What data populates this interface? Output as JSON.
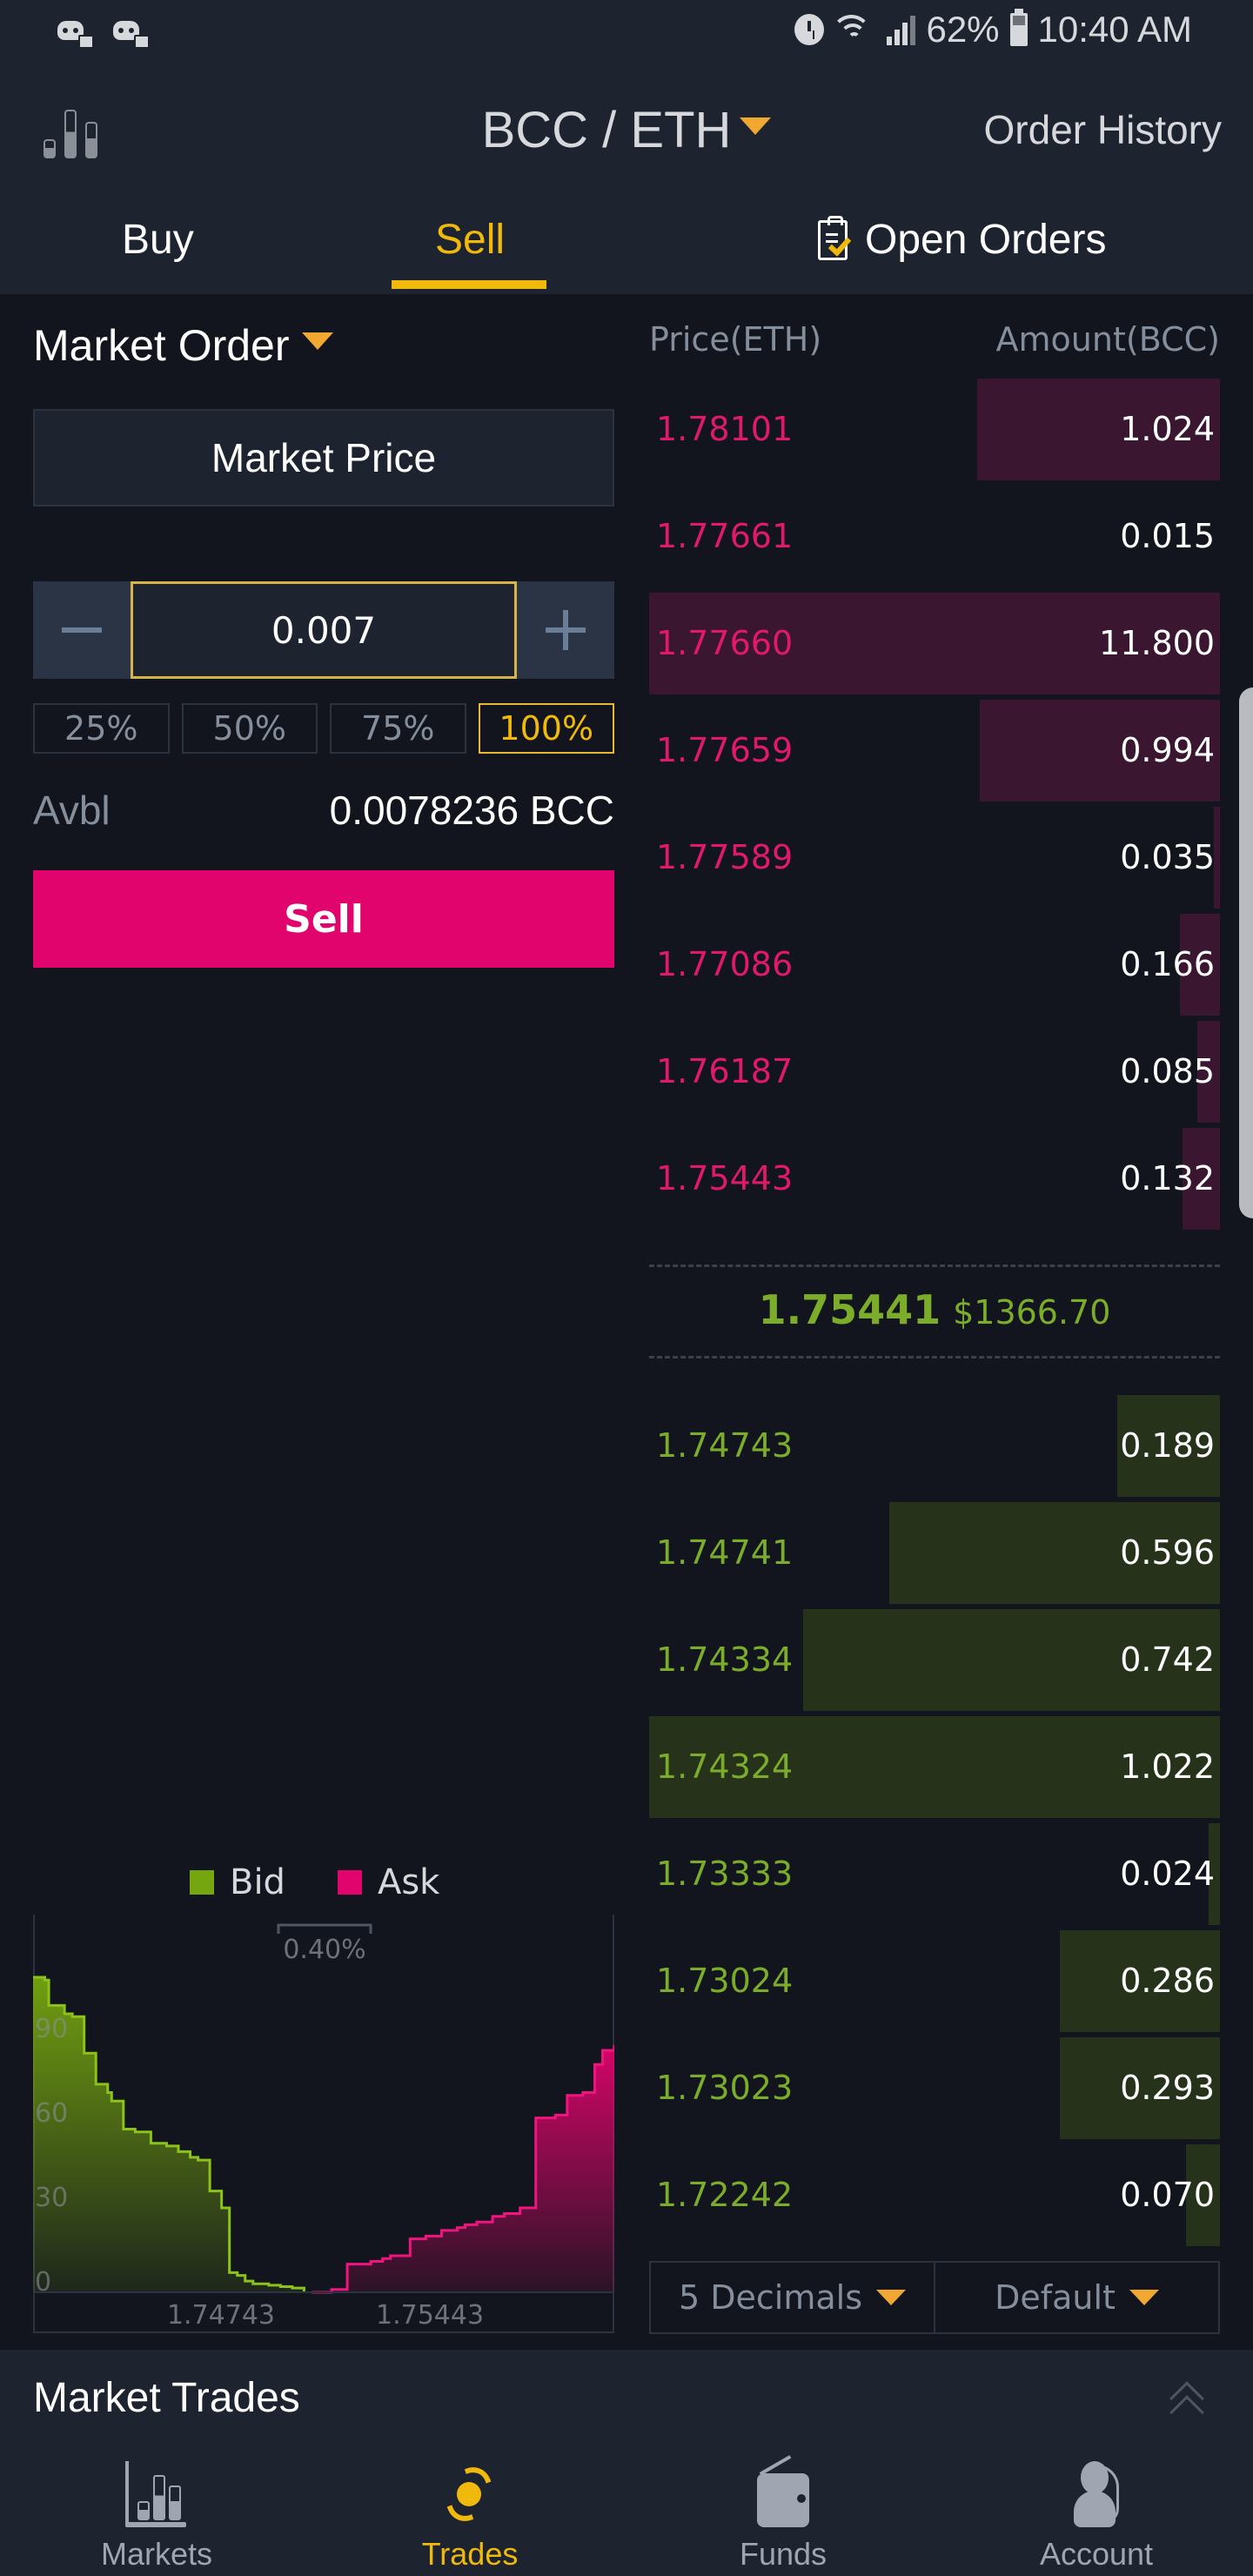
{
  "status_bar": {
    "notification_icons": [
      "discord-icon",
      "discord-icon"
    ],
    "battery_percent": "62%",
    "time": "10:40 AM",
    "icons": [
      "alarm-icon",
      "wifi-icon",
      "signal-icon",
      "battery-icon"
    ]
  },
  "header": {
    "pair": "BCC / ETH",
    "order_history": "Order History"
  },
  "tabs": [
    {
      "label": "Buy",
      "active": false
    },
    {
      "label": "Sell",
      "active": true
    },
    {
      "label": "Open Orders",
      "active": false
    }
  ],
  "form": {
    "order_type": "Market Order",
    "price_display": "Market Price",
    "amount": "0.007",
    "percent_options": [
      "25%",
      "50%",
      "75%",
      "100%"
    ],
    "selected_percent": "100%",
    "avbl_label": "Avbl",
    "avbl_value": "0.0078236",
    "avbl_currency": "BCC",
    "submit_label": "Sell"
  },
  "order_book": {
    "header_price": "Price(ETH)",
    "header_amount": "Amount(BCC)",
    "asks": [
      {
        "price": "1.78101",
        "amount": "1.024",
        "depth": 0.425
      },
      {
        "price": "1.77661",
        "amount": "0.015",
        "depth": 0.0
      },
      {
        "price": "1.77660",
        "amount": "11.800",
        "depth": 1.0
      },
      {
        "price": "1.77659",
        "amount": "0.994",
        "depth": 0.42
      },
      {
        "price": "1.77589",
        "amount": "0.035",
        "depth": 0.01
      },
      {
        "price": "1.77086",
        "amount": "0.166",
        "depth": 0.07
      },
      {
        "price": "1.76187",
        "amount": "0.085",
        "depth": 0.04
      },
      {
        "price": "1.75443",
        "amount": "0.132",
        "depth": 0.065
      }
    ],
    "last_price": "1.75441",
    "last_price_usd": "$1366.70",
    "bids": [
      {
        "price": "1.74743",
        "amount": "0.189",
        "depth": 0.18
      },
      {
        "price": "1.74741",
        "amount": "0.596",
        "depth": 0.58
      },
      {
        "price": "1.74334",
        "amount": "0.742",
        "depth": 0.73
      },
      {
        "price": "1.74324",
        "amount": "1.022",
        "depth": 1.0
      },
      {
        "price": "1.73333",
        "amount": "0.024",
        "depth": 0.02
      },
      {
        "price": "1.73024",
        "amount": "0.286",
        "depth": 0.28
      },
      {
        "price": "1.73023",
        "amount": "0.293",
        "depth": 0.28
      },
      {
        "price": "1.72242",
        "amount": "0.070",
        "depth": 0.06
      }
    ],
    "decimals_label": "5 Decimals",
    "view_label": "Default"
  },
  "colors": {
    "bid": "#7cad2a",
    "ask": "#e0046c",
    "accent": "#f0b90b"
  },
  "chart_data": {
    "type": "area",
    "title": "",
    "legend": [
      {
        "name": "Bid",
        "color": "#76a60f"
      },
      {
        "name": "Ask",
        "color": "#e0046c"
      }
    ],
    "legend_placement": "top-center",
    "spread_label": "0.40%",
    "yticks": [
      "0",
      "30",
      "60",
      "90"
    ],
    "ylim": [
      0,
      125
    ],
    "xticks": [
      "1.74743",
      "1.75443"
    ],
    "series": [
      {
        "name": "Bid",
        "x_index": [
          0,
          0.03,
          0.04,
          0.08,
          0.1,
          0.13,
          0.16,
          0.19,
          0.2,
          0.23,
          0.26,
          0.3,
          0.34,
          0.37,
          0.4,
          0.42,
          0.45,
          0.48,
          0.5,
          0.52,
          0.54,
          0.56,
          0.6,
          0.63,
          0.66,
          0.69
        ],
        "values": [
          112,
          111,
          102,
          99,
          98,
          85,
          74,
          71,
          68,
          58,
          57,
          53,
          52,
          50,
          48,
          47,
          36,
          30,
          7,
          6,
          4,
          3,
          2.5,
          2,
          1.5,
          0
        ]
      },
      {
        "name": "Ask",
        "x_index": [
          0.71,
          0.76,
          0.78,
          0.8,
          0.86,
          0.89,
          0.91,
          0.96,
          1.0,
          1.04,
          1.08,
          1.1,
          1.13,
          1.17,
          1.2,
          1.24,
          1.28,
          1.33,
          1.36,
          1.4,
          1.43,
          1.45,
          1.48
        ],
        "values": [
          0,
          1,
          1,
          10,
          11,
          12,
          13,
          19,
          20,
          22,
          23,
          24,
          25,
          27,
          28,
          30,
          62,
          63,
          70,
          71,
          81,
          86,
          88
        ]
      }
    ]
  },
  "market_trades": {
    "title": "Market Trades"
  },
  "bottom_nav": [
    {
      "label": "Markets",
      "icon": "markets-icon",
      "active": false
    },
    {
      "label": "Trades",
      "icon": "trades-icon",
      "active": true
    },
    {
      "label": "Funds",
      "icon": "wallet-icon",
      "active": false
    },
    {
      "label": "Account",
      "icon": "account-icon",
      "active": false
    }
  ]
}
